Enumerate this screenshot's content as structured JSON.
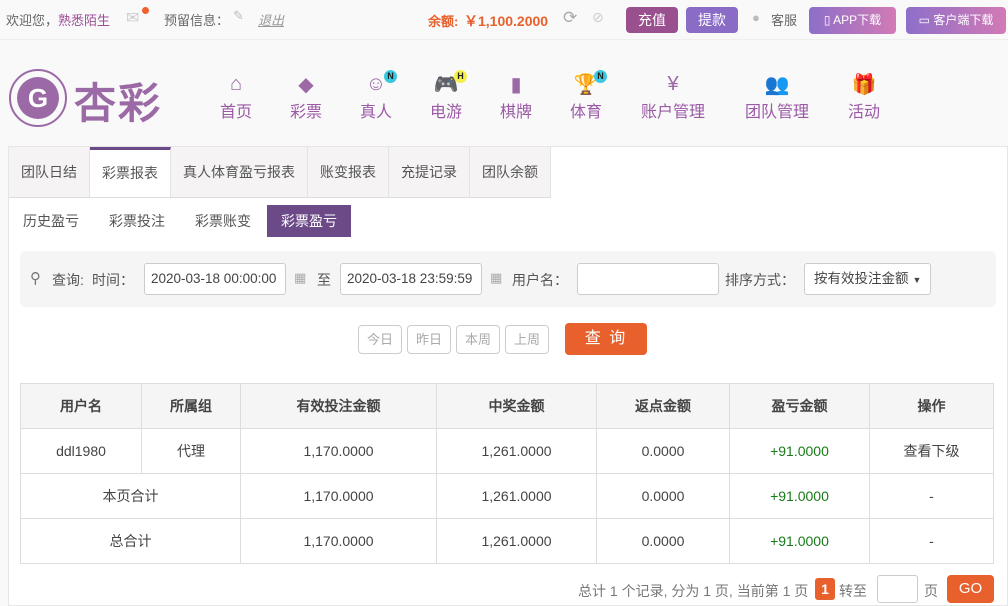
{
  "topbar": {
    "welcome": "欢迎您，",
    "username": "熟悉陌生",
    "reserved_label": "预留信息：",
    "logout": "退出",
    "balance_label": "余额:",
    "balance": "￥1,100.2000",
    "recharge": "充值",
    "withdraw": "提款",
    "service": "客服",
    "app_download": "APP下载",
    "client_download": "客户端下载"
  },
  "logo": {
    "text": "杏彩"
  },
  "nav": [
    {
      "label": "首页"
    },
    {
      "label": "彩票"
    },
    {
      "label": "真人",
      "badge": "N"
    },
    {
      "label": "电游",
      "badge": "H"
    },
    {
      "label": "棋牌"
    },
    {
      "label": "体育",
      "badge": "N"
    },
    {
      "label": "账户管理"
    },
    {
      "label": "团队管理"
    },
    {
      "label": "活动"
    }
  ],
  "tabs": [
    "团队日结",
    "彩票报表",
    "真人体育盈亏报表",
    "账变报表",
    "充提记录",
    "团队余额"
  ],
  "subtabs": [
    "历史盈亏",
    "彩票投注",
    "彩票账变",
    "彩票盈亏"
  ],
  "filter": {
    "query_label": "查询:",
    "time_label": "时间：",
    "start": "2020-03-18 00:00:00",
    "to": "至",
    "end": "2020-03-18 23:59:59",
    "user_label": "用户名：",
    "user_value": "",
    "sort_label": "排序方式：",
    "sort_value": "按有效投注金额"
  },
  "quick": [
    "今日",
    "昨日",
    "本周",
    "上周"
  ],
  "search_btn": "查 询",
  "table": {
    "headers": [
      "用户名",
      "所属组",
      "有效投注金额",
      "中奖金额",
      "返点金额",
      "盈亏金额",
      "操作"
    ],
    "row": [
      "ddl1980",
      "代理",
      "1,170.0000",
      "1,261.0000",
      "0.0000",
      "+91.0000",
      "查看下级"
    ],
    "page_total": [
      "本页合计",
      "1,170.0000",
      "1,261.0000",
      "0.0000",
      "+91.0000",
      "-"
    ],
    "grand_total": [
      "总合计",
      "1,170.0000",
      "1,261.0000",
      "0.0000",
      "+91.0000",
      "-"
    ]
  },
  "pager": {
    "summary": "总计 1 个记录, 分为 1 页, 当前第 1 页",
    "current": "1",
    "goto": "转至",
    "page": "页",
    "go": "GO"
  },
  "colors": {
    "purple": "#6b4a87",
    "orange": "#e8602c",
    "green": "#1a7a1a"
  }
}
